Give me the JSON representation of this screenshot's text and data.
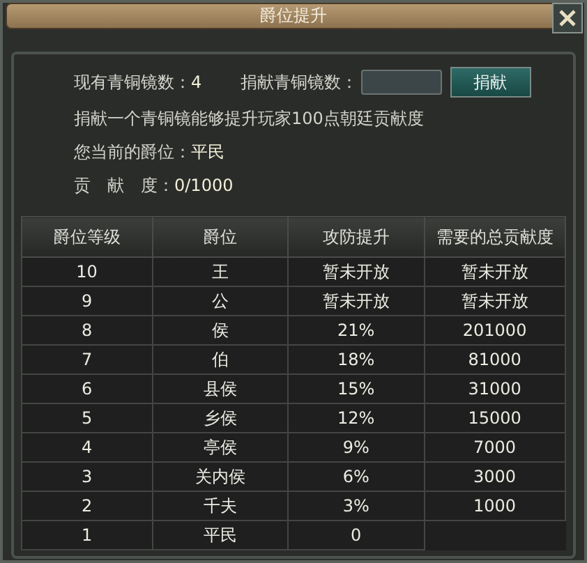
{
  "window": {
    "title": "爵位提升"
  },
  "donate": {
    "owned_label": "现有青铜镜数：",
    "owned_value": "4",
    "amount_label": "捐献青铜镜数：",
    "button": "捐献"
  },
  "info": "捐献一个青铜镜能够提升玩家100点朝廷贡献度",
  "current": {
    "label": "您当前的爵位：",
    "value": "平民"
  },
  "contribution": {
    "label": "贡　献　度：",
    "value": "0/1000"
  },
  "table": {
    "columns": [
      "爵位等级",
      "爵位",
      "攻防提升",
      "需要的总贡献度"
    ],
    "rows": [
      [
        "10",
        "王",
        "暂未开放",
        "暂未开放"
      ],
      [
        "9",
        "公",
        "暂未开放",
        "暂未开放"
      ],
      [
        "8",
        "侯",
        "21%",
        "201000"
      ],
      [
        "7",
        "伯",
        "18%",
        "81000"
      ],
      [
        "6",
        "县侯",
        "15%",
        "31000"
      ],
      [
        "5",
        "乡侯",
        "12%",
        "15000"
      ],
      [
        "4",
        "亭侯",
        "9%",
        "7000"
      ],
      [
        "3",
        "关内侯",
        "6%",
        "3000"
      ],
      [
        "2",
        "千夫",
        "3%",
        "1000"
      ],
      [
        "1",
        "平民",
        "0"
      ]
    ]
  }
}
